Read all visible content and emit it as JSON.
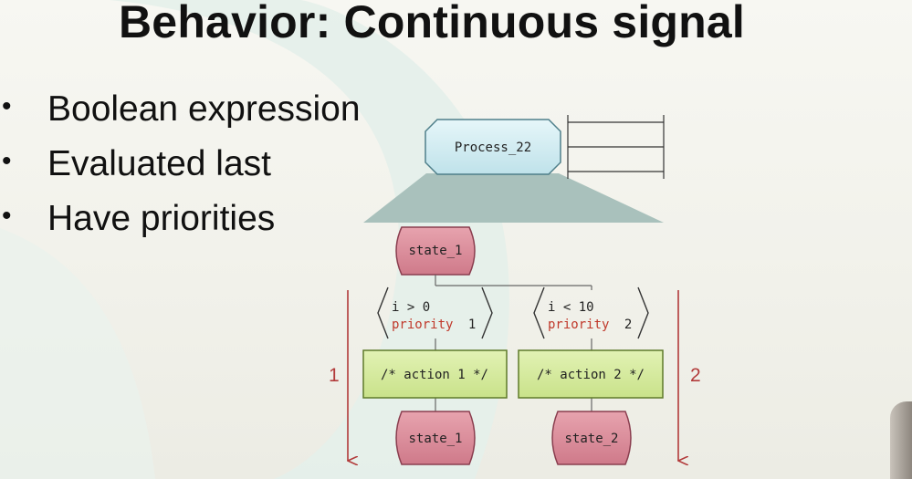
{
  "slide": {
    "title": "Behavior: Continuous signal",
    "bullets": [
      "Boolean expression",
      "Evaluated last",
      "Have priorities"
    ],
    "bullet_glyph": "•"
  },
  "diagram": {
    "process": {
      "label": "Process_22"
    },
    "start_state": {
      "label": "state_1"
    },
    "branches": [
      {
        "condition": "i > 0",
        "priority_keyword": "priority",
        "priority_value": "1",
        "action": "/* action 1 */",
        "next_state": "state_1",
        "order_label": "1"
      },
      {
        "condition": "i < 10",
        "priority_keyword": "priority",
        "priority_value": "2",
        "action": "/* action 2 */",
        "next_state": "state_2",
        "order_label": "2"
      }
    ]
  },
  "colors": {
    "process_fill": "#cfeaf0",
    "state_fill": "#d98a98",
    "action_fill": "#d4ea9a",
    "funnel_fill": "#a8c0bb",
    "priority_text": "#c0392b",
    "arrow_red": "#b23a3a",
    "swoosh": "#e3efe9"
  }
}
